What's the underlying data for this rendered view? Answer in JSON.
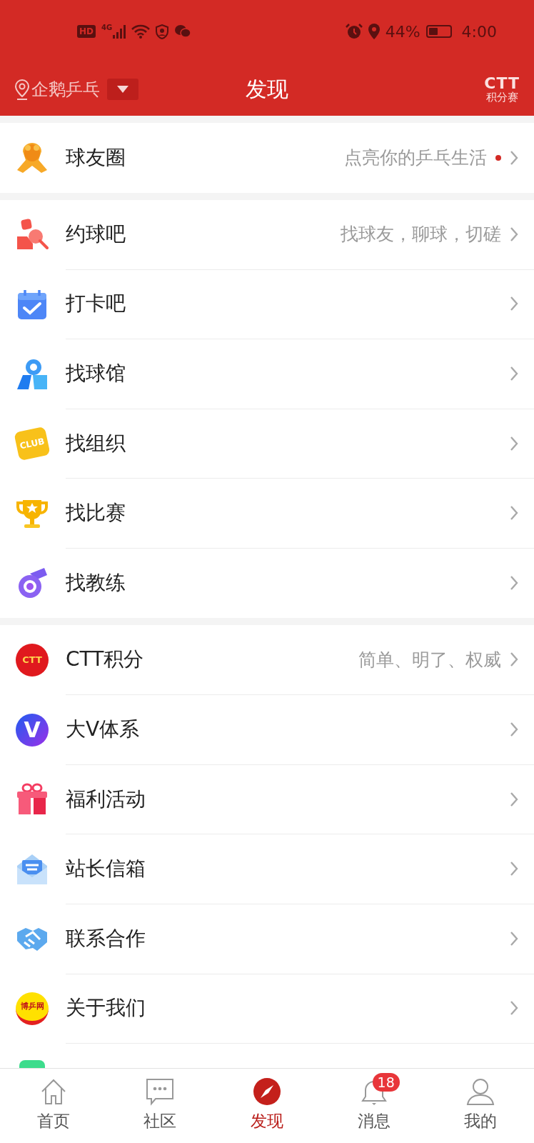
{
  "status_bar": {
    "left": [
      {
        "kind": "hd",
        "text": "HD"
      },
      {
        "kind": "signal",
        "text": "4G"
      },
      {
        "kind": "wifi"
      },
      {
        "kind": "shield"
      },
      {
        "kind": "chat"
      }
    ],
    "battery_text": "44%",
    "time": "4:00"
  },
  "header": {
    "location": "企鹅乒乓",
    "title": "发现",
    "logo_top": "CTT",
    "logo_bottom": "积分赛"
  },
  "sections": [
    {
      "items": [
        {
          "kind": "goose",
          "label": "球友圈",
          "subtitle": "点亮你的乒乓生活",
          "dot": true
        }
      ]
    },
    {
      "items": [
        {
          "kind": "meet",
          "label": "约球吧",
          "subtitle": "找球友，聊球，切磋"
        },
        {
          "kind": "checkin",
          "label": "打卡吧"
        },
        {
          "kind": "venue",
          "label": "找球馆"
        },
        {
          "kind": "club",
          "icon_text": "CLUB",
          "label": "找组织"
        },
        {
          "kind": "trophy",
          "label": "找比赛"
        },
        {
          "kind": "whistle",
          "label": "找教练"
        }
      ]
    },
    {
      "items": [
        {
          "kind": "ctt",
          "icon_text": "CTT",
          "label": "CTT积分",
          "subtitle": "简单、明了、权威"
        },
        {
          "kind": "v",
          "icon_text": "V",
          "label": "大V体系"
        },
        {
          "kind": "gift",
          "label": "福利活动"
        },
        {
          "kind": "mail",
          "label": "站长信箱"
        },
        {
          "kind": "handshake",
          "label": "联系合作"
        },
        {
          "kind": "about",
          "icon_text": "博乒网",
          "label": "关于我们"
        },
        {
          "kind": "partial"
        }
      ]
    }
  ],
  "tabs": [
    {
      "kind": "home",
      "label": "首页",
      "selected": false
    },
    {
      "kind": "chat",
      "label": "社区",
      "selected": false
    },
    {
      "kind": "compass",
      "label": "发现",
      "selected": true
    },
    {
      "kind": "bell",
      "label": "消息",
      "selected": false,
      "badge": "18"
    },
    {
      "kind": "user",
      "label": "我的",
      "selected": false
    }
  ]
}
